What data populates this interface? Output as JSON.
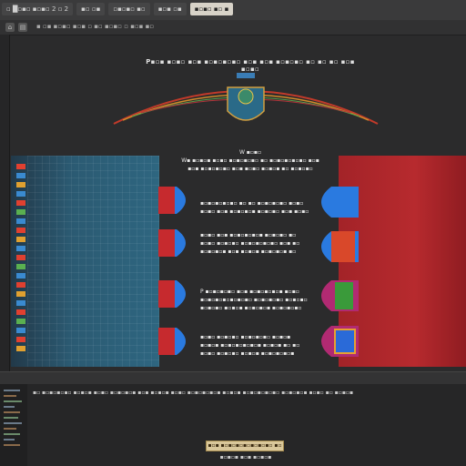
{
  "window": {
    "tabs": [
      "▫ █▫▪▫ ▪▫▪▫ 2 ▫ 2",
      "▪▫ ▫▪",
      "▫▪▫▪▫ ▪▫",
      "▪▫▪ ▫▪",
      "▪▫▪▫ ▪▫ ▪"
    ],
    "active_tab_index": 4,
    "path": "▪ ▫▪ ▪▫▪▫ ▪▫▪ ▫ ▪▫ ▪▫▪▫ ▫ ▪▫▪ ▪▫"
  },
  "toolbar": {
    "icons": [
      "home-icon",
      "file-icon",
      "gear-icon",
      "search-icon"
    ]
  },
  "header": {
    "line": "P▪▫▪ ▪▫▪▫ ▪▫▪ ▪▫▪▫▪▫▪▫ ▪▫▪ ▪▫▪ ▪▫▪▫▪▫ ▪▫ ▪▫ ▪▫ ▪▫▪ ▪▫▪▫"
  },
  "subtitle": {
    "line1": "W ▪▫▪▫",
    "line2": "W▪ ▪▫▪▫▪ ▪▫▪▫ ▪▫▪▫▪▫▪▫ ▪▫ ▪▫▪▫▪▫▪▫▪▫ ▪▫▪",
    "line3": "▪▫▪ ▪▫▪▫▪▫▪▫ ▪▫▪ ▪▫▪▫ ▪▫▪▫▪ ▪▫ ▪▫▪▫▪▫"
  },
  "rows": [
    {
      "line1": "▪▫▪▫▪▫▪▫▪▫ ▪▫ ▪▫ ▪▫▪▫▪▫▪▫ ▪▫▪▫",
      "line2": "▪▫▪▫ ▪▫▪ ▪▫▪▫▪▫▪ ▪▫▪▫▪▫ ▪▫▪ ▪▫▪▫"
    },
    {
      "line1": "▪▫▪▫ ▪▫▪ ▪▫▪▫▪▫▪▫▪ ▪▫▪▫▪▫ ▪▫",
      "line2": "▪▫▪▫ ▪▫▪▫▪▫ ▪▫▪▫▪▫▪▫▪▫ ▪▫▪ ▪▫",
      "line3": "▪▫▪▫▪▫▪ ▪▫▪ ▪▫▪▫▪ ▪▫▪▫▪▫▪ ▪▫"
    },
    {
      "line1": "P ▪▫▪▫▪▫▪▫ ▪▫▪ ▪▫▪▫▪▫▪▫▪ ▪▫▪▫",
      "line2": "▪▫▪▫▪▫▪▫▪▫▪▫▪▫ ▪▫▪▫▪▫▪▫ ▪▫▪▫▪▫",
      "line3": "▪▫▪▫▪▫ ▪▫▪▫▪ ▪▫▪▫▪▫▪ ▪▫▪▫▪▫▪▫"
    },
    {
      "line1": "▪▫▪▫ ▪▫▪▫▪▫ ▪▫▪▫▪▫▪▫ ▪▫▪▫▪",
      "line2": "▪▫▪▫▪ ▪▫▪▫▪▫▪▫▪▫▪ ▪▫▪▫▪ ▪▫ ▪▫",
      "line3": "▪▫▪▫ ▪▫▪▫▪▫ ▪▫▪▫▪ ▪▫▪▫▪▫▪▫▪"
    }
  ],
  "console": {
    "line": "▪▫ ▪▫▪▫▪▫▪▫ ▪▫▪▫▪ ▪▫▪▫ ▪▫▪▫▪▫▪ ▪▫▪ ▪▫▪▫▪ ▪▫▪▫ ▪▫▪▫▪▫▪▫▪ ▪▫▪▫▪ ▪▫▪▫▪▫▪▫▪▫ ▪▫▪▫▪▫▪ ▪▫▪▫ ▪▫ ▪▫▪▫▪"
  },
  "status": {
    "badge": "▪▫▪ ▪▫▪▫▪▫▪▫▪▫▪▫▪▫ ▪▫",
    "sub": "▪▫▪▫▪ ▪▫▪ ▪▫▪▫▪"
  },
  "colors": {
    "blue": "#2e6680",
    "red": "#b72a2e",
    "accent_gold": "#d9c79a",
    "bg": "#2b2b2c"
  }
}
